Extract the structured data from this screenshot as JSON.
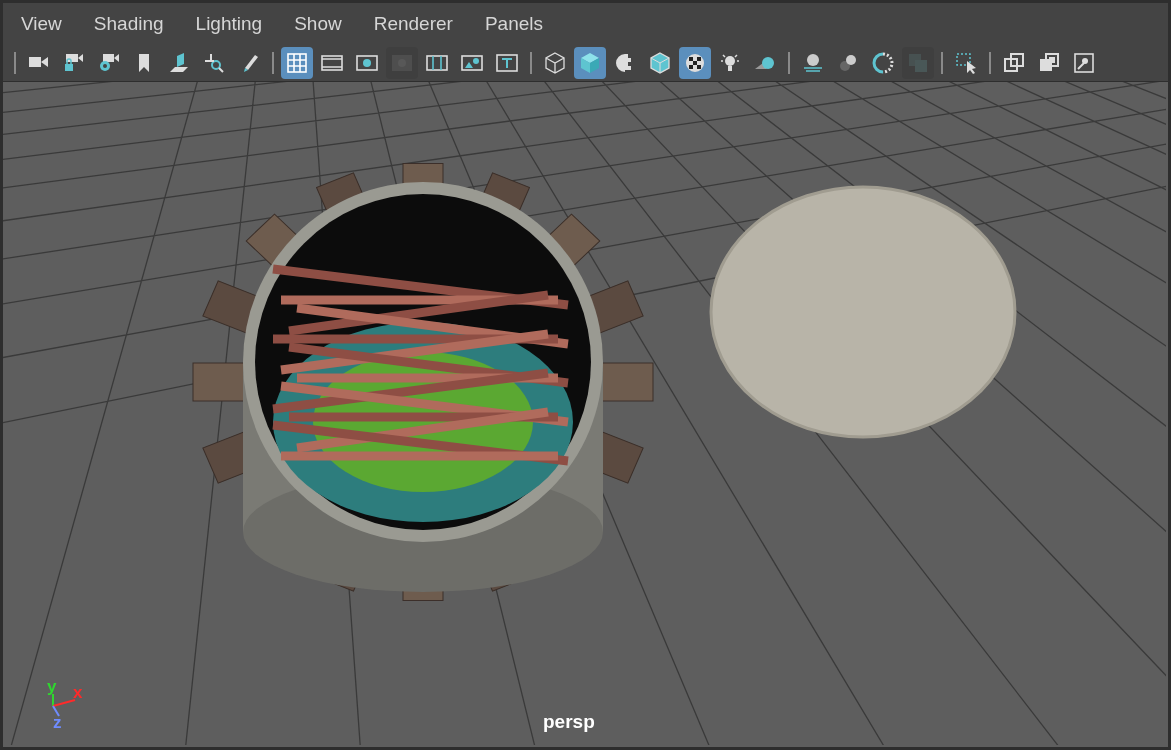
{
  "menu": [
    "View",
    "Shading",
    "Lighting",
    "Show",
    "Renderer",
    "Panels"
  ],
  "toolbar": [
    {
      "tools": [
        {
          "kind": "camera",
          "selected": false
        },
        {
          "kind": "camlock",
          "selected": false
        },
        {
          "kind": "camattr",
          "selected": false
        },
        {
          "kind": "bookmark",
          "selected": false
        },
        {
          "kind": "imageplane",
          "selected": false
        },
        {
          "kind": "pan",
          "selected": false
        },
        {
          "kind": "pencil",
          "selected": false
        }
      ]
    },
    {
      "tools": [
        {
          "kind": "grid",
          "selected": true
        },
        {
          "kind": "film",
          "selected": false
        },
        {
          "kind": "resgate",
          "selected": false
        },
        {
          "kind": "gatemask",
          "selected": false,
          "disabled": true
        },
        {
          "kind": "fieldchart",
          "selected": false
        },
        {
          "kind": "safeaction",
          "selected": false
        },
        {
          "kind": "safetitle",
          "selected": false
        }
      ]
    },
    {
      "tools": [
        {
          "kind": "wire",
          "selected": false
        },
        {
          "kind": "shaded",
          "selected": true
        },
        {
          "kind": "halfsphere",
          "selected": false
        },
        {
          "kind": "wireshaded",
          "selected": false
        },
        {
          "kind": "textured",
          "selected": true
        },
        {
          "kind": "light",
          "selected": false
        },
        {
          "kind": "shadow",
          "selected": false
        }
      ]
    },
    {
      "tools": [
        {
          "kind": "occlusion",
          "selected": false
        },
        {
          "kind": "blur",
          "selected": false
        },
        {
          "kind": "antialias",
          "selected": false
        },
        {
          "kind": "dof",
          "selected": false,
          "disabled": true
        }
      ]
    },
    {
      "tools": [
        {
          "kind": "isolate",
          "selected": false
        }
      ]
    },
    {
      "tools": [
        {
          "kind": "xray",
          "selected": false
        },
        {
          "kind": "xrayjoint",
          "selected": false
        },
        {
          "kind": "xrayactive",
          "selected": false
        }
      ]
    }
  ],
  "viewport": {
    "camera": "persp",
    "axes": [
      {
        "label": "y",
        "color": "#2fd62f"
      },
      {
        "label": "x",
        "color": "#ff2a2a"
      },
      {
        "label": "z",
        "color": "#6f8cff"
      }
    ]
  }
}
